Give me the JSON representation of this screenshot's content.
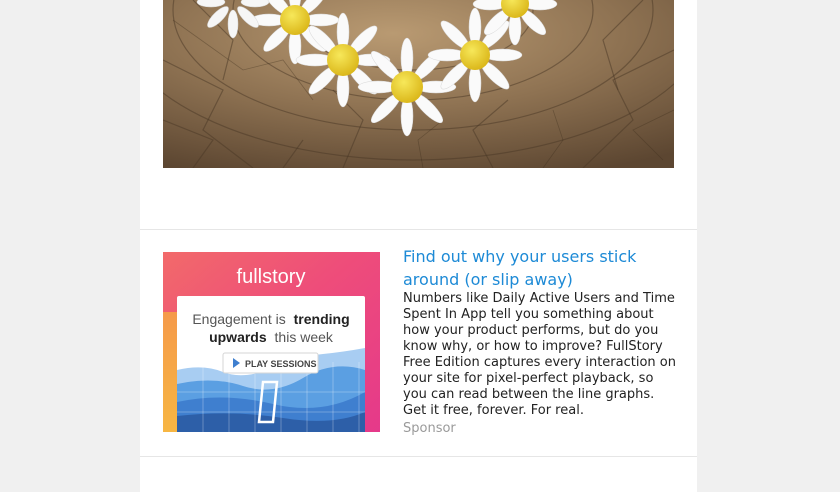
{
  "hero": {
    "alt": "daisy flowers on a wooden stump"
  },
  "sponsored": {
    "title": "Find out why your users stick around (or slip away)",
    "body": "Numbers like Daily Active Users and Time Spent In App tell you something about how your product performs, but do you know why, or how to improve? FullStory Free Edition captures every interaction on your site for pixel-perfect playback, so you can read between the line graphs. Get it free, forever. For real.",
    "label": "Sponsor",
    "image": {
      "brand": "fullstory",
      "headline_line1_normal": "Engagement is",
      "headline_line1_bold": "trending",
      "headline_line2_bold": "upwards",
      "headline_line2_normal": "this week",
      "button_label": "PLAY SESSIONS"
    }
  },
  "colors": {
    "page_bg": "#f0f0f0",
    "card_bg": "#ffffff",
    "link_blue": "#1d8ad6",
    "sponsor_gray": "#9a9a9a",
    "divider": "#e6e6e6"
  }
}
